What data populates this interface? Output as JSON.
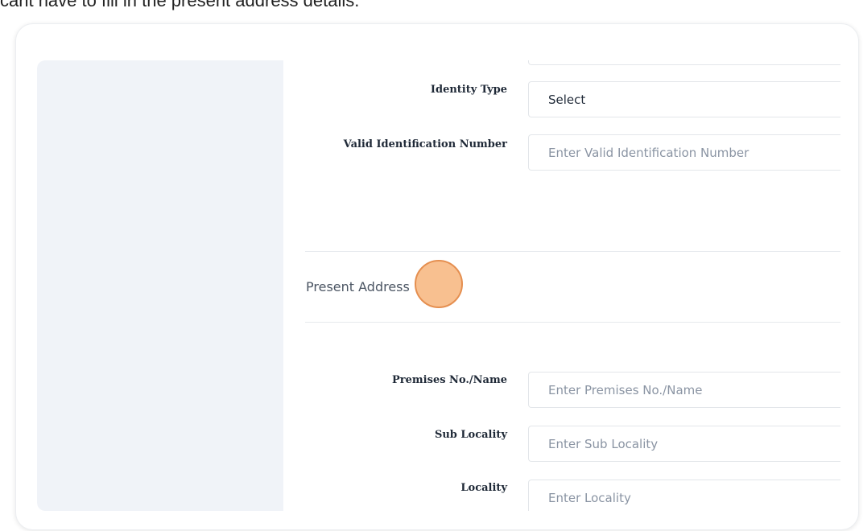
{
  "caption": "cant have to fill in the present address details.",
  "identity": {
    "type_label": "Identity Type",
    "type_value": "Select",
    "id_label": "Valid Identification Number",
    "id_placeholder": "Enter Valid Identification Number"
  },
  "present_address": {
    "title": "Present Address",
    "premises_label": "Premises No./Name",
    "premises_placeholder": "Enter Premises No./Name",
    "sub_locality_label": "Sub Locality",
    "sub_locality_placeholder": "Enter Sub Locality",
    "locality_label": "Locality",
    "locality_placeholder": "Enter Locality"
  },
  "colors": {
    "sidebar": "#f0f3f8",
    "click_marker": "#f7b278"
  }
}
